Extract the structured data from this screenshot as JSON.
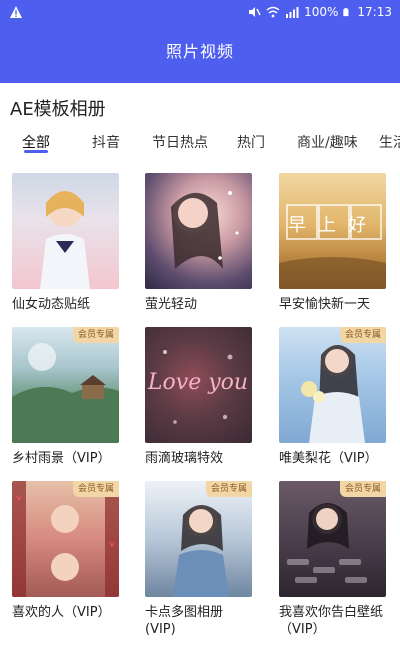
{
  "status_bar": {
    "battery_percent": "100%",
    "time": "17:13"
  },
  "header": {
    "title": "照片视频"
  },
  "section": {
    "title": "AE模板相册"
  },
  "tabs": [
    {
      "label": "全部",
      "active": true
    },
    {
      "label": "抖音"
    },
    {
      "label": "节日热点"
    },
    {
      "label": "热门"
    },
    {
      "label": "商业/趣味"
    },
    {
      "label": "生活"
    }
  ],
  "badge_text": "会员专属",
  "accent_color": "#4e5ff0",
  "cards": [
    {
      "title": "仙女动态贴纸",
      "vip_badge": false,
      "thumb_text": ""
    },
    {
      "title": "萤光轻动",
      "vip_badge": false,
      "thumb_text": ""
    },
    {
      "title": "早安愉快新一天",
      "vip_badge": false,
      "thumb_text": "早上好"
    },
    {
      "title": "乡村雨景（VIP）",
      "vip_badge": true,
      "thumb_text": ""
    },
    {
      "title": "雨滴玻璃特效",
      "vip_badge": false,
      "thumb_text": "Love you"
    },
    {
      "title": "唯美梨花（VIP）",
      "vip_badge": true,
      "thumb_text": ""
    },
    {
      "title": "喜欢的人（VIP）",
      "vip_badge": true,
      "thumb_text": ""
    },
    {
      "title": "卡点多图相册\n(VIP)",
      "vip_badge": true,
      "thumb_text": ""
    },
    {
      "title": "我喜欢你告白壁纸\n（VIP）",
      "vip_badge": true,
      "thumb_text": ""
    }
  ]
}
